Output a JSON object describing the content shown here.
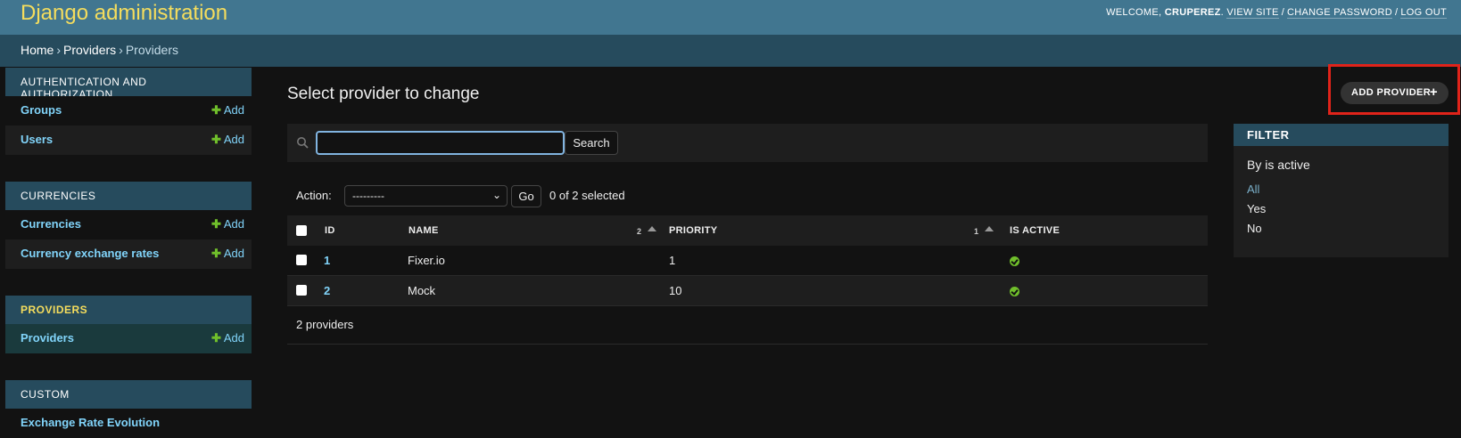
{
  "header": {
    "site_title": "Django administration",
    "welcome": "WELCOME,",
    "username": "CRUPEREZ",
    "view_site": "VIEW SITE",
    "change_password": "CHANGE PASSWORD",
    "log_out": "LOG OUT"
  },
  "breadcrumbs": [
    "Home",
    "Providers",
    "Providers"
  ],
  "sidebar": {
    "modules": [
      {
        "caption": "AUTHENTICATION AND AUTHORIZATION",
        "items": [
          {
            "label": "Groups",
            "add": "Add"
          },
          {
            "label": "Users",
            "add": "Add"
          }
        ]
      },
      {
        "caption": "CURRENCIES",
        "items": [
          {
            "label": "Currencies",
            "add": "Add"
          },
          {
            "label": "Currency exchange rates",
            "add": "Add"
          }
        ]
      },
      {
        "caption": "PROVIDERS",
        "items": [
          {
            "label": "Providers",
            "add": "Add"
          }
        ]
      },
      {
        "caption": "CUSTOM",
        "items": [
          {
            "label": "Exchange Rate Evolution"
          }
        ]
      }
    ]
  },
  "content": {
    "title": "Select provider to change",
    "add_button": "ADD PROVIDER",
    "search": {
      "value": "",
      "button": "Search"
    },
    "actions": {
      "label": "Action:",
      "selected": "---------",
      "go": "Go",
      "counter": "0 of 2 selected"
    },
    "table": {
      "headers": {
        "id": "ID",
        "name": "NAME",
        "name_sort": "2",
        "priority": "PRIORITY",
        "priority_sort": "1",
        "is_active": "IS ACTIVE"
      },
      "rows": [
        {
          "id": "1",
          "name": "Fixer.io",
          "priority": "1",
          "is_active": true
        },
        {
          "id": "2",
          "name": "Mock",
          "priority": "10",
          "is_active": true
        }
      ]
    },
    "paginator": "2 providers"
  },
  "filter": {
    "caption": "FILTER",
    "heading": "By is active",
    "options": [
      "All",
      "Yes",
      "No"
    ],
    "selected": "All"
  },
  "colors": {
    "header_bg": "#417690",
    "breadcrumbs_bg": "#264b5d",
    "site_title": "#f5dd5d",
    "link": "#81d4fa",
    "add_green": "#70bf2b",
    "highlight_box": "#e0231a"
  }
}
